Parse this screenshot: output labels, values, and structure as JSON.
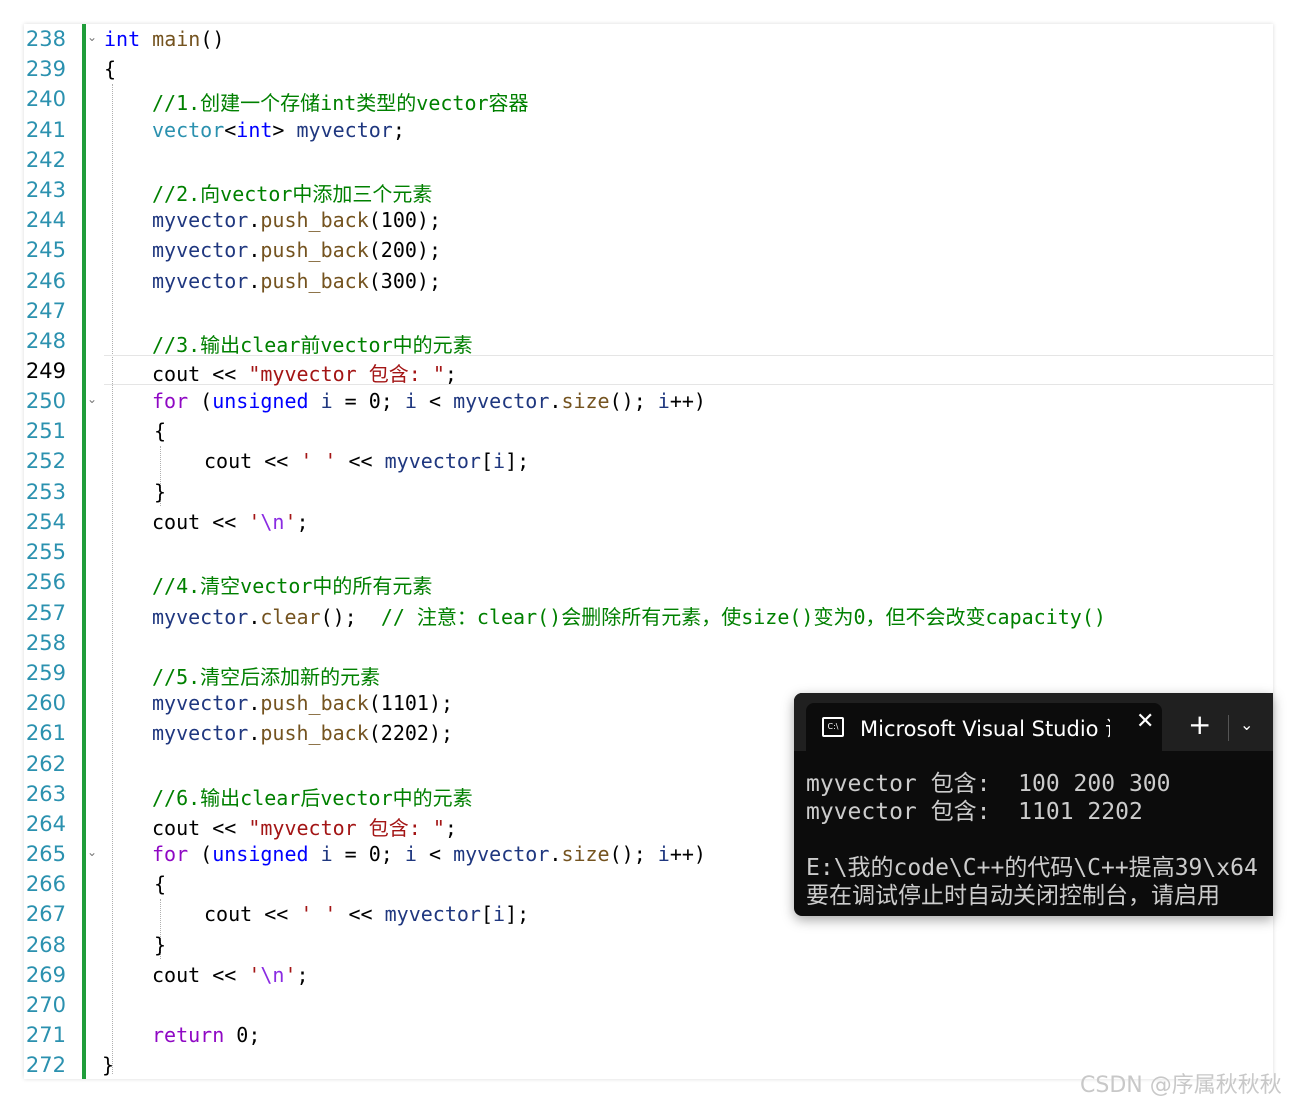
{
  "editor": {
    "lines": [
      {
        "n": "238"
      },
      {
        "n": "239"
      },
      {
        "n": "240"
      },
      {
        "n": "241"
      },
      {
        "n": "242"
      },
      {
        "n": "243"
      },
      {
        "n": "244"
      },
      {
        "n": "245"
      },
      {
        "n": "246"
      },
      {
        "n": "247"
      },
      {
        "n": "248"
      },
      {
        "n": "249"
      },
      {
        "n": "250"
      },
      {
        "n": "251"
      },
      {
        "n": "252"
      },
      {
        "n": "253"
      },
      {
        "n": "254"
      },
      {
        "n": "255"
      },
      {
        "n": "256"
      },
      {
        "n": "257"
      },
      {
        "n": "258"
      },
      {
        "n": "259"
      },
      {
        "n": "260"
      },
      {
        "n": "261"
      },
      {
        "n": "262"
      },
      {
        "n": "263"
      },
      {
        "n": "264"
      },
      {
        "n": "265"
      },
      {
        "n": "266"
      },
      {
        "n": "267"
      },
      {
        "n": "268"
      },
      {
        "n": "269"
      },
      {
        "n": "270"
      },
      {
        "n": "271"
      },
      {
        "n": "272"
      }
    ],
    "current_line": "249",
    "code": {
      "l238_kw": "int",
      "l238_fn": "main",
      "l238_p": "()",
      "l239": "{",
      "l240": "//1.创建一个存储int类型的vector容器",
      "l241_a": "vector",
      "l241_b": "<",
      "l241_c": "int",
      "l241_d": "> ",
      "l241_e": "myvector",
      "l241_f": ";",
      "l243": "//2.向vector中添加三个元素",
      "l244_a": "myvector",
      "l244_b": ".",
      "l244_c": "push_back",
      "l244_d": "(100);",
      "l245_a": "myvector",
      "l245_b": ".",
      "l245_c": "push_back",
      "l245_d": "(200);",
      "l246_a": "myvector",
      "l246_b": ".",
      "l246_c": "push_back",
      "l246_d": "(300);",
      "l248": "//3.输出clear前vector中的元素",
      "l249_a": "cout ",
      "l249_b": "<< ",
      "l249_c": "\"myvector 包含: \"",
      "l249_d": ";",
      "l250_a": "for",
      "l250_b": " (",
      "l250_c": "unsigned",
      "l250_d": " ",
      "l250_e": "i",
      "l250_f": " = 0; ",
      "l250_g": "i",
      "l250_h": " < ",
      "l250_i": "myvector",
      "l250_j": ".",
      "l250_k": "size",
      "l250_l": "(); ",
      "l250_m": "i",
      "l250_n": "++)",
      "l251": "{",
      "l252_a": "cout ",
      "l252_b": "<< ",
      "l252_c": "' '",
      "l252_d": " << ",
      "l252_e": "myvector",
      "l252_f": "[",
      "l252_g": "i",
      "l252_h": "];",
      "l253": "}",
      "l254_a": "cout ",
      "l254_b": "<< ",
      "l254_c": "'",
      "l254_d": "\\n",
      "l254_e": "'",
      "l254_f": ";",
      "l256": "//4.清空vector中的所有元素",
      "l257_a": "myvector",
      "l257_b": ".",
      "l257_c": "clear",
      "l257_d": "();  ",
      "l257_e": "// 注意：clear()会删除所有元素，使size()变为0，但不会改变capacity()",
      "l259": "//5.清空后添加新的元素",
      "l260_a": "myvector",
      "l260_b": ".",
      "l260_c": "push_back",
      "l260_d": "(1101);",
      "l261_a": "myvector",
      "l261_b": ".",
      "l261_c": "push_back",
      "l261_d": "(2202);",
      "l263": "//6.输出clear后vector中的元素",
      "l264_a": "cout ",
      "l264_b": "<< ",
      "l264_c": "\"myvector 包含: \"",
      "l264_d": ";",
      "l265_a": "for",
      "l265_b": " (",
      "l265_c": "unsigned",
      "l265_d": " ",
      "l265_e": "i",
      "l265_f": " = 0; ",
      "l265_g": "i",
      "l265_h": " < ",
      "l265_i": "myvector",
      "l265_j": ".",
      "l265_k": "size",
      "l265_l": "(); ",
      "l265_m": "i",
      "l265_n": "++)",
      "l266": "{",
      "l267_a": "cout ",
      "l267_b": "<< ",
      "l267_c": "' '",
      "l267_d": " << ",
      "l267_e": "myvector",
      "l267_f": "[",
      "l267_g": "i",
      "l267_h": "];",
      "l268": "}",
      "l269_a": "cout ",
      "l269_b": "<< ",
      "l269_c": "'",
      "l269_d": "\\n",
      "l269_e": "'",
      "l269_f": ";",
      "l271_a": "return",
      "l271_b": " 0;",
      "l272": "}"
    },
    "change_bar_color": "#1f9d3a"
  },
  "console": {
    "tab_title": "Microsoft Visual Studio 调试控制台",
    "tab_icon_text": "C:\\",
    "close_glyph": "✕",
    "new_tab_glyph": "+",
    "dropdown_glyph": "⌄",
    "output_lines": [
      "myvector 包含:  100 200 300",
      "myvector 包含:  1101 2202",
      "",
      "E:\\我的code\\C++的代码\\C++提高39\\x64",
      "要在调试停止时自动关闭控制台，请启用"
    ]
  },
  "watermark": "CSDN @序属秋秋秋"
}
